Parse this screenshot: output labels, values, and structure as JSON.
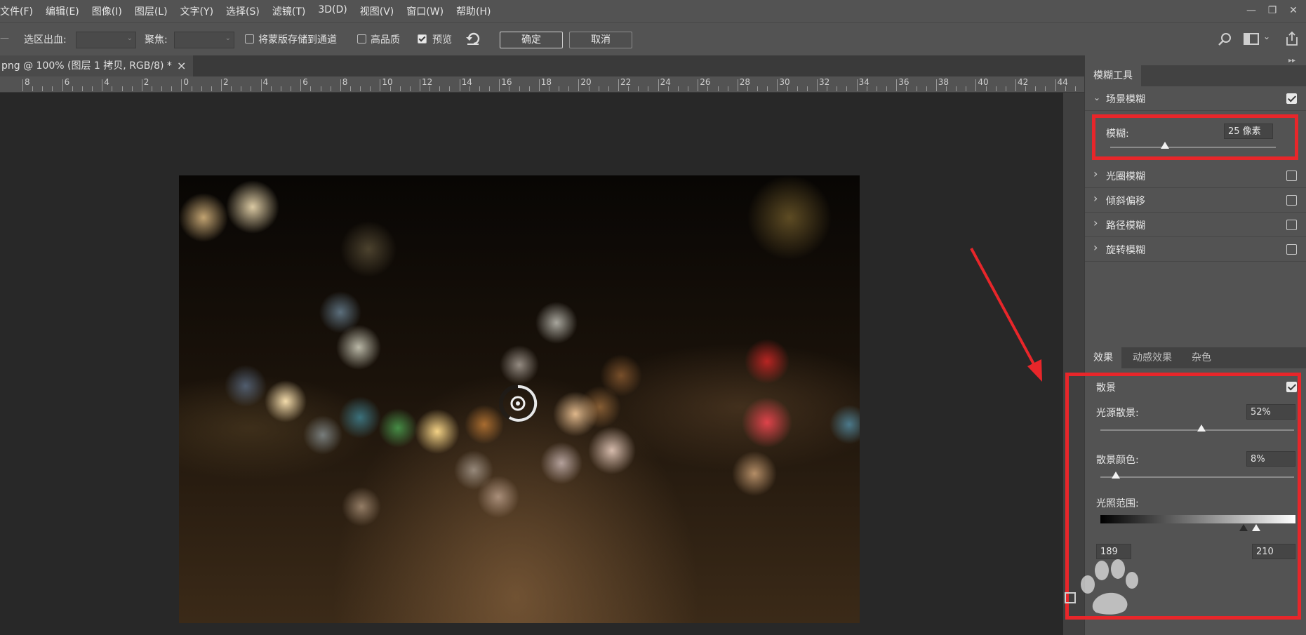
{
  "menu": [
    "文件(F)",
    "编辑(E)",
    "图像(I)",
    "图层(L)",
    "文字(Y)",
    "选择(S)",
    "滤镜(T)",
    "3D(D)",
    "视图(V)",
    "窗口(W)",
    "帮助(H)"
  ],
  "options": {
    "selection_bleed_label": "选区出血:",
    "focus_label": "聚焦:",
    "save_mask_label": "将蒙版存储到通道",
    "save_mask_checked": false,
    "high_quality_label": "高品质",
    "high_quality_checked": false,
    "preview_label": "预览",
    "preview_checked": true,
    "ok_label": "确定",
    "cancel_label": "取消"
  },
  "document_tab": {
    "title": "png @ 100% (图层 1 拷贝, RGB/8) *",
    "close_glyph": "×"
  },
  "ruler": [
    "8",
    "6",
    "4",
    "2",
    "0",
    "2",
    "4",
    "6",
    "8",
    "10",
    "12",
    "14",
    "16",
    "18",
    "20",
    "22",
    "24",
    "26",
    "28",
    "30",
    "32",
    "34",
    "36",
    "38",
    "40",
    "42",
    "44"
  ],
  "blur_tools": {
    "tab_label": "模糊工具",
    "field_blur": {
      "label": "场景模糊",
      "checked": true,
      "blur_label": "模糊:",
      "blur_value": "25 像素",
      "blur_level": 0.33
    },
    "other_blurs": [
      {
        "label": "光圈模糊",
        "checked": false
      },
      {
        "label": "倾斜偏移",
        "checked": false
      },
      {
        "label": "路径模糊",
        "checked": false
      },
      {
        "label": "旋转模糊",
        "checked": false
      }
    ]
  },
  "effects": {
    "tabs": [
      "效果",
      "动感效果",
      "杂色"
    ],
    "bokeh_label": "散景",
    "bokeh_checked": true,
    "light_bokeh_label": "光源散景:",
    "light_bokeh_value": "52%",
    "light_bokeh_level": 0.52,
    "bokeh_color_label": "散景颜色:",
    "bokeh_color_value": "8%",
    "bokeh_color_level": 0.08,
    "light_range_label": "光照范围:",
    "light_range_low": "189",
    "light_range_high": "210"
  },
  "colors": {
    "highlight": "#e8262a",
    "panel_bg": "#535353",
    "canvas_bg": "#282828"
  }
}
